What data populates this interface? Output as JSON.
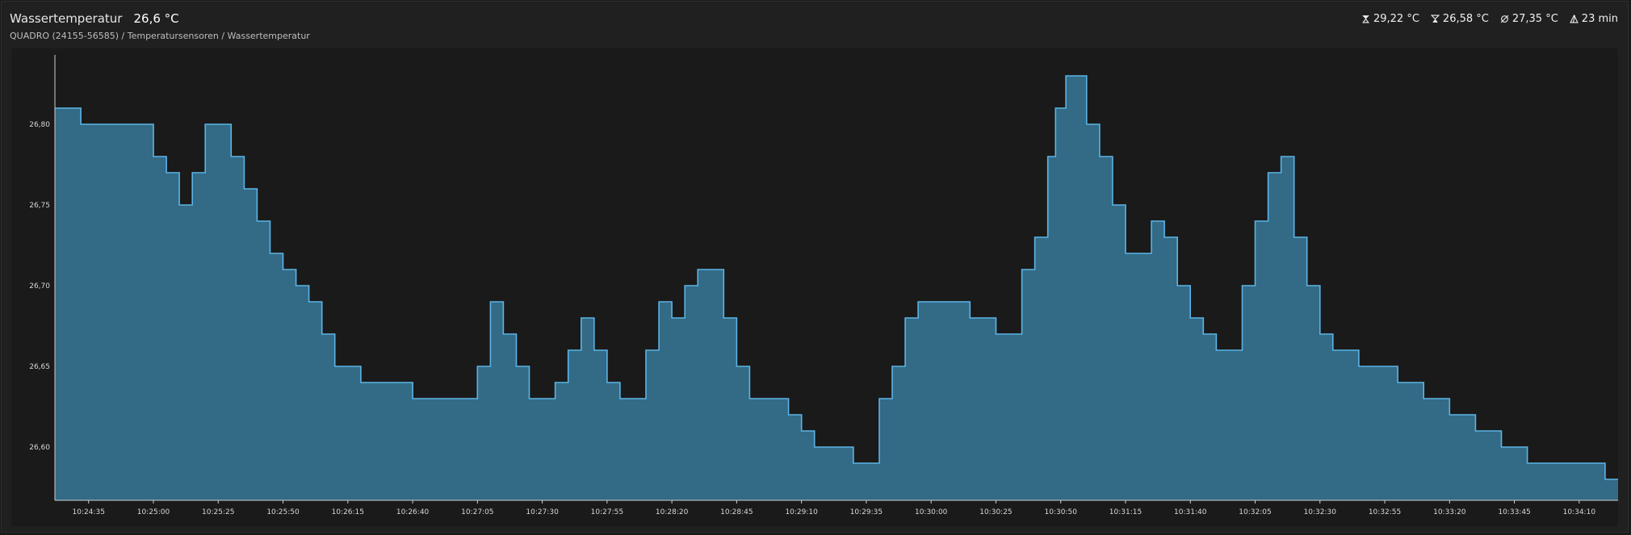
{
  "header": {
    "title": "Wassertemperatur",
    "current_value": "26,6 °C",
    "breadcrumb": "QUADRO (24155-56585) / Temperatursensoren / Wassertemperatur"
  },
  "stats": [
    {
      "icon": "max-icon",
      "value": "29,22 °C"
    },
    {
      "icon": "min-icon",
      "value": "26,58 °C"
    },
    {
      "icon": "average-icon",
      "value": "27,35 °C"
    },
    {
      "icon": "duration-icon",
      "value": "23 min"
    }
  ],
  "colors": {
    "line": "#5bb4e6",
    "fill": "#336a86",
    "background": "#1a1a1a"
  },
  "chart_data": {
    "type": "area",
    "y_ticks": [
      "26,60",
      "26,65",
      "26,70",
      "26,75",
      "26,80"
    ],
    "y_tick_values": [
      26.6,
      26.65,
      26.7,
      26.75,
      26.8
    ],
    "x_ticks": [
      "10:24:35",
      "10:25:00",
      "10:25:25",
      "10:25:50",
      "10:26:15",
      "10:26:40",
      "10:27:05",
      "10:27:30",
      "10:27:55",
      "10:28:20",
      "10:28:45",
      "10:29:10",
      "10:29:35",
      "10:30:00",
      "10:30:25",
      "10:30:50",
      "10:31:15",
      "10:31:40",
      "10:32:05",
      "10:32:30",
      "10:32:55",
      "10:33:20",
      "10:33:45",
      "10:34:10"
    ],
    "ylim": [
      26.567,
      26.843
    ],
    "x_start": "10:24:22",
    "x_end": "10:34:25",
    "times": [
      "10:24:22",
      "10:24:27",
      "10:24:32",
      "10:24:40",
      "10:24:50",
      "10:25:00",
      "10:25:05",
      "10:25:10",
      "10:25:15",
      "10:25:20",
      "10:25:25",
      "10:25:30",
      "10:25:35",
      "10:25:40",
      "10:25:45",
      "10:25:50",
      "10:25:55",
      "10:26:00",
      "10:26:05",
      "10:26:10",
      "10:26:15",
      "10:26:20",
      "10:26:25",
      "10:26:30",
      "10:26:40",
      "10:26:50",
      "10:27:00",
      "10:27:05",
      "10:27:10",
      "10:27:15",
      "10:27:20",
      "10:27:25",
      "10:27:30",
      "10:27:35",
      "10:27:40",
      "10:27:45",
      "10:27:50",
      "10:27:55",
      "10:28:00",
      "10:28:05",
      "10:28:10",
      "10:28:15",
      "10:28:20",
      "10:28:25",
      "10:28:30",
      "10:28:35",
      "10:28:40",
      "10:28:45",
      "10:28:50",
      "10:28:55",
      "10:29:00",
      "10:29:05",
      "10:29:10",
      "10:29:15",
      "10:29:20",
      "10:29:25",
      "10:29:30",
      "10:29:35",
      "10:29:40",
      "10:29:45",
      "10:29:50",
      "10:29:55",
      "10:30:00",
      "10:30:05",
      "10:30:10",
      "10:30:15",
      "10:30:20",
      "10:30:25",
      "10:30:30",
      "10:30:35",
      "10:30:40",
      "10:30:45",
      "10:30:48",
      "10:30:52",
      "10:30:55",
      "10:31:00",
      "10:31:05",
      "10:31:10",
      "10:31:15",
      "10:31:20",
      "10:31:25",
      "10:31:30",
      "10:31:35",
      "10:31:40",
      "10:31:45",
      "10:31:50",
      "10:31:55",
      "10:32:00",
      "10:32:05",
      "10:32:10",
      "10:32:15",
      "10:32:20",
      "10:32:25",
      "10:32:30",
      "10:32:35",
      "10:32:40",
      "10:32:45",
      "10:32:50",
      "10:32:55",
      "10:33:00",
      "10:33:05",
      "10:33:10",
      "10:33:15",
      "10:33:20",
      "10:33:25",
      "10:33:30",
      "10:33:35",
      "10:33:40",
      "10:33:45",
      "10:33:50",
      "10:33:55",
      "10:34:00",
      "10:34:05",
      "10:34:10",
      "10:34:15",
      "10:34:20",
      "10:34:25"
    ],
    "values": [
      26.81,
      26.81,
      26.8,
      26.8,
      26.8,
      26.78,
      26.77,
      26.75,
      26.77,
      26.8,
      26.8,
      26.78,
      26.76,
      26.74,
      26.72,
      26.71,
      26.7,
      26.69,
      26.67,
      26.65,
      26.65,
      26.64,
      26.64,
      26.64,
      26.63,
      26.63,
      26.63,
      26.65,
      26.69,
      26.67,
      26.65,
      26.63,
      26.63,
      26.64,
      26.66,
      26.68,
      26.66,
      26.64,
      26.63,
      26.63,
      26.66,
      26.69,
      26.68,
      26.7,
      26.71,
      26.71,
      26.68,
      26.65,
      26.63,
      26.63,
      26.63,
      26.62,
      26.61,
      26.6,
      26.6,
      26.6,
      26.59,
      26.59,
      26.63,
      26.65,
      26.68,
      26.69,
      26.69,
      26.69,
      26.69,
      26.68,
      26.68,
      26.67,
      26.67,
      26.71,
      26.73,
      26.78,
      26.81,
      26.83,
      26.83,
      26.8,
      26.78,
      26.75,
      26.72,
      26.72,
      26.74,
      26.73,
      26.7,
      26.68,
      26.67,
      26.66,
      26.66,
      26.7,
      26.74,
      26.77,
      26.78,
      26.73,
      26.7,
      26.67,
      26.66,
      26.66,
      26.65,
      26.65,
      26.65,
      26.64,
      26.64,
      26.63,
      26.63,
      26.62,
      26.62,
      26.61,
      26.61,
      26.6,
      26.6,
      26.59,
      26.59,
      26.59,
      26.59,
      26.59,
      26.59,
      26.58,
      26.58
    ]
  }
}
